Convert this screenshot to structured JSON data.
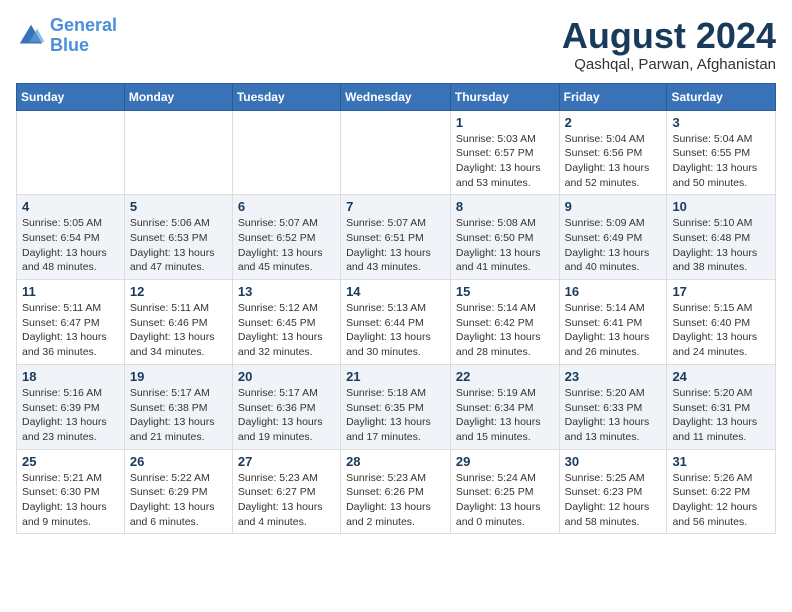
{
  "logo": {
    "line1": "General",
    "line2": "Blue"
  },
  "title": "August 2024",
  "subtitle": "Qashqal, Parwan, Afghanistan",
  "days_of_week": [
    "Sunday",
    "Monday",
    "Tuesday",
    "Wednesday",
    "Thursday",
    "Friday",
    "Saturday"
  ],
  "weeks": [
    [
      {
        "num": "",
        "detail": ""
      },
      {
        "num": "",
        "detail": ""
      },
      {
        "num": "",
        "detail": ""
      },
      {
        "num": "",
        "detail": ""
      },
      {
        "num": "1",
        "detail": "Sunrise: 5:03 AM\nSunset: 6:57 PM\nDaylight: 13 hours\nand 53 minutes."
      },
      {
        "num": "2",
        "detail": "Sunrise: 5:04 AM\nSunset: 6:56 PM\nDaylight: 13 hours\nand 52 minutes."
      },
      {
        "num": "3",
        "detail": "Sunrise: 5:04 AM\nSunset: 6:55 PM\nDaylight: 13 hours\nand 50 minutes."
      }
    ],
    [
      {
        "num": "4",
        "detail": "Sunrise: 5:05 AM\nSunset: 6:54 PM\nDaylight: 13 hours\nand 48 minutes."
      },
      {
        "num": "5",
        "detail": "Sunrise: 5:06 AM\nSunset: 6:53 PM\nDaylight: 13 hours\nand 47 minutes."
      },
      {
        "num": "6",
        "detail": "Sunrise: 5:07 AM\nSunset: 6:52 PM\nDaylight: 13 hours\nand 45 minutes."
      },
      {
        "num": "7",
        "detail": "Sunrise: 5:07 AM\nSunset: 6:51 PM\nDaylight: 13 hours\nand 43 minutes."
      },
      {
        "num": "8",
        "detail": "Sunrise: 5:08 AM\nSunset: 6:50 PM\nDaylight: 13 hours\nand 41 minutes."
      },
      {
        "num": "9",
        "detail": "Sunrise: 5:09 AM\nSunset: 6:49 PM\nDaylight: 13 hours\nand 40 minutes."
      },
      {
        "num": "10",
        "detail": "Sunrise: 5:10 AM\nSunset: 6:48 PM\nDaylight: 13 hours\nand 38 minutes."
      }
    ],
    [
      {
        "num": "11",
        "detail": "Sunrise: 5:11 AM\nSunset: 6:47 PM\nDaylight: 13 hours\nand 36 minutes."
      },
      {
        "num": "12",
        "detail": "Sunrise: 5:11 AM\nSunset: 6:46 PM\nDaylight: 13 hours\nand 34 minutes."
      },
      {
        "num": "13",
        "detail": "Sunrise: 5:12 AM\nSunset: 6:45 PM\nDaylight: 13 hours\nand 32 minutes."
      },
      {
        "num": "14",
        "detail": "Sunrise: 5:13 AM\nSunset: 6:44 PM\nDaylight: 13 hours\nand 30 minutes."
      },
      {
        "num": "15",
        "detail": "Sunrise: 5:14 AM\nSunset: 6:42 PM\nDaylight: 13 hours\nand 28 minutes."
      },
      {
        "num": "16",
        "detail": "Sunrise: 5:14 AM\nSunset: 6:41 PM\nDaylight: 13 hours\nand 26 minutes."
      },
      {
        "num": "17",
        "detail": "Sunrise: 5:15 AM\nSunset: 6:40 PM\nDaylight: 13 hours\nand 24 minutes."
      }
    ],
    [
      {
        "num": "18",
        "detail": "Sunrise: 5:16 AM\nSunset: 6:39 PM\nDaylight: 13 hours\nand 23 minutes."
      },
      {
        "num": "19",
        "detail": "Sunrise: 5:17 AM\nSunset: 6:38 PM\nDaylight: 13 hours\nand 21 minutes."
      },
      {
        "num": "20",
        "detail": "Sunrise: 5:17 AM\nSunset: 6:36 PM\nDaylight: 13 hours\nand 19 minutes."
      },
      {
        "num": "21",
        "detail": "Sunrise: 5:18 AM\nSunset: 6:35 PM\nDaylight: 13 hours\nand 17 minutes."
      },
      {
        "num": "22",
        "detail": "Sunrise: 5:19 AM\nSunset: 6:34 PM\nDaylight: 13 hours\nand 15 minutes."
      },
      {
        "num": "23",
        "detail": "Sunrise: 5:20 AM\nSunset: 6:33 PM\nDaylight: 13 hours\nand 13 minutes."
      },
      {
        "num": "24",
        "detail": "Sunrise: 5:20 AM\nSunset: 6:31 PM\nDaylight: 13 hours\nand 11 minutes."
      }
    ],
    [
      {
        "num": "25",
        "detail": "Sunrise: 5:21 AM\nSunset: 6:30 PM\nDaylight: 13 hours\nand 9 minutes."
      },
      {
        "num": "26",
        "detail": "Sunrise: 5:22 AM\nSunset: 6:29 PM\nDaylight: 13 hours\nand 6 minutes."
      },
      {
        "num": "27",
        "detail": "Sunrise: 5:23 AM\nSunset: 6:27 PM\nDaylight: 13 hours\nand 4 minutes."
      },
      {
        "num": "28",
        "detail": "Sunrise: 5:23 AM\nSunset: 6:26 PM\nDaylight: 13 hours\nand 2 minutes."
      },
      {
        "num": "29",
        "detail": "Sunrise: 5:24 AM\nSunset: 6:25 PM\nDaylight: 13 hours\nand 0 minutes."
      },
      {
        "num": "30",
        "detail": "Sunrise: 5:25 AM\nSunset: 6:23 PM\nDaylight: 12 hours\nand 58 minutes."
      },
      {
        "num": "31",
        "detail": "Sunrise: 5:26 AM\nSunset: 6:22 PM\nDaylight: 12 hours\nand 56 minutes."
      }
    ]
  ]
}
